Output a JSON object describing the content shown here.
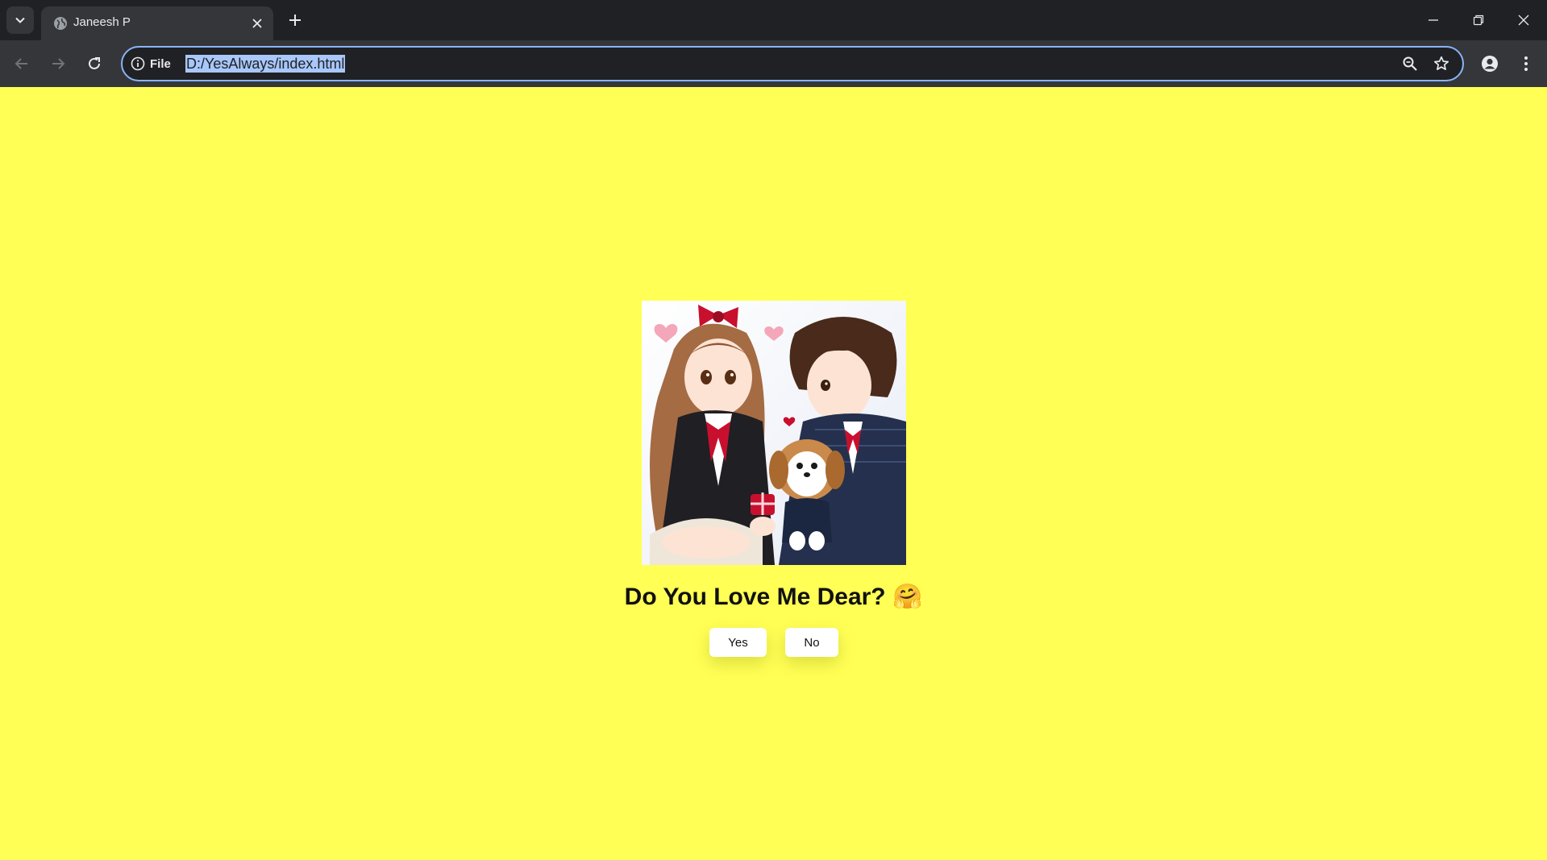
{
  "browser": {
    "tab": {
      "title": "Janeesh P"
    },
    "omnibox": {
      "site_info_label": "File",
      "url": "D:/YesAlways/index.html"
    },
    "icons": {
      "tab_search": "chevron-down-icon",
      "favicon": "globe-icon",
      "tab_close": "close-icon",
      "new_tab": "plus-icon",
      "minimize": "minimize-icon",
      "restore": "restore-icon",
      "close_window": "close-icon",
      "back": "back-arrow-icon",
      "forward": "forward-arrow-icon",
      "reload": "reload-icon",
      "info": "info-icon",
      "zoom": "zoom-icon",
      "bookmark": "star-icon",
      "profile": "profile-icon",
      "menu": "kebab-menu-icon"
    },
    "colors": {
      "frame": "#202124",
      "toolbar": "#35363a",
      "omnibox_focus": "#8ab4f8"
    }
  },
  "page": {
    "background": "#ffff55",
    "question": "Do You Love Me Dear? 🤗",
    "buttons": {
      "yes": "Yes",
      "no": "No"
    }
  }
}
